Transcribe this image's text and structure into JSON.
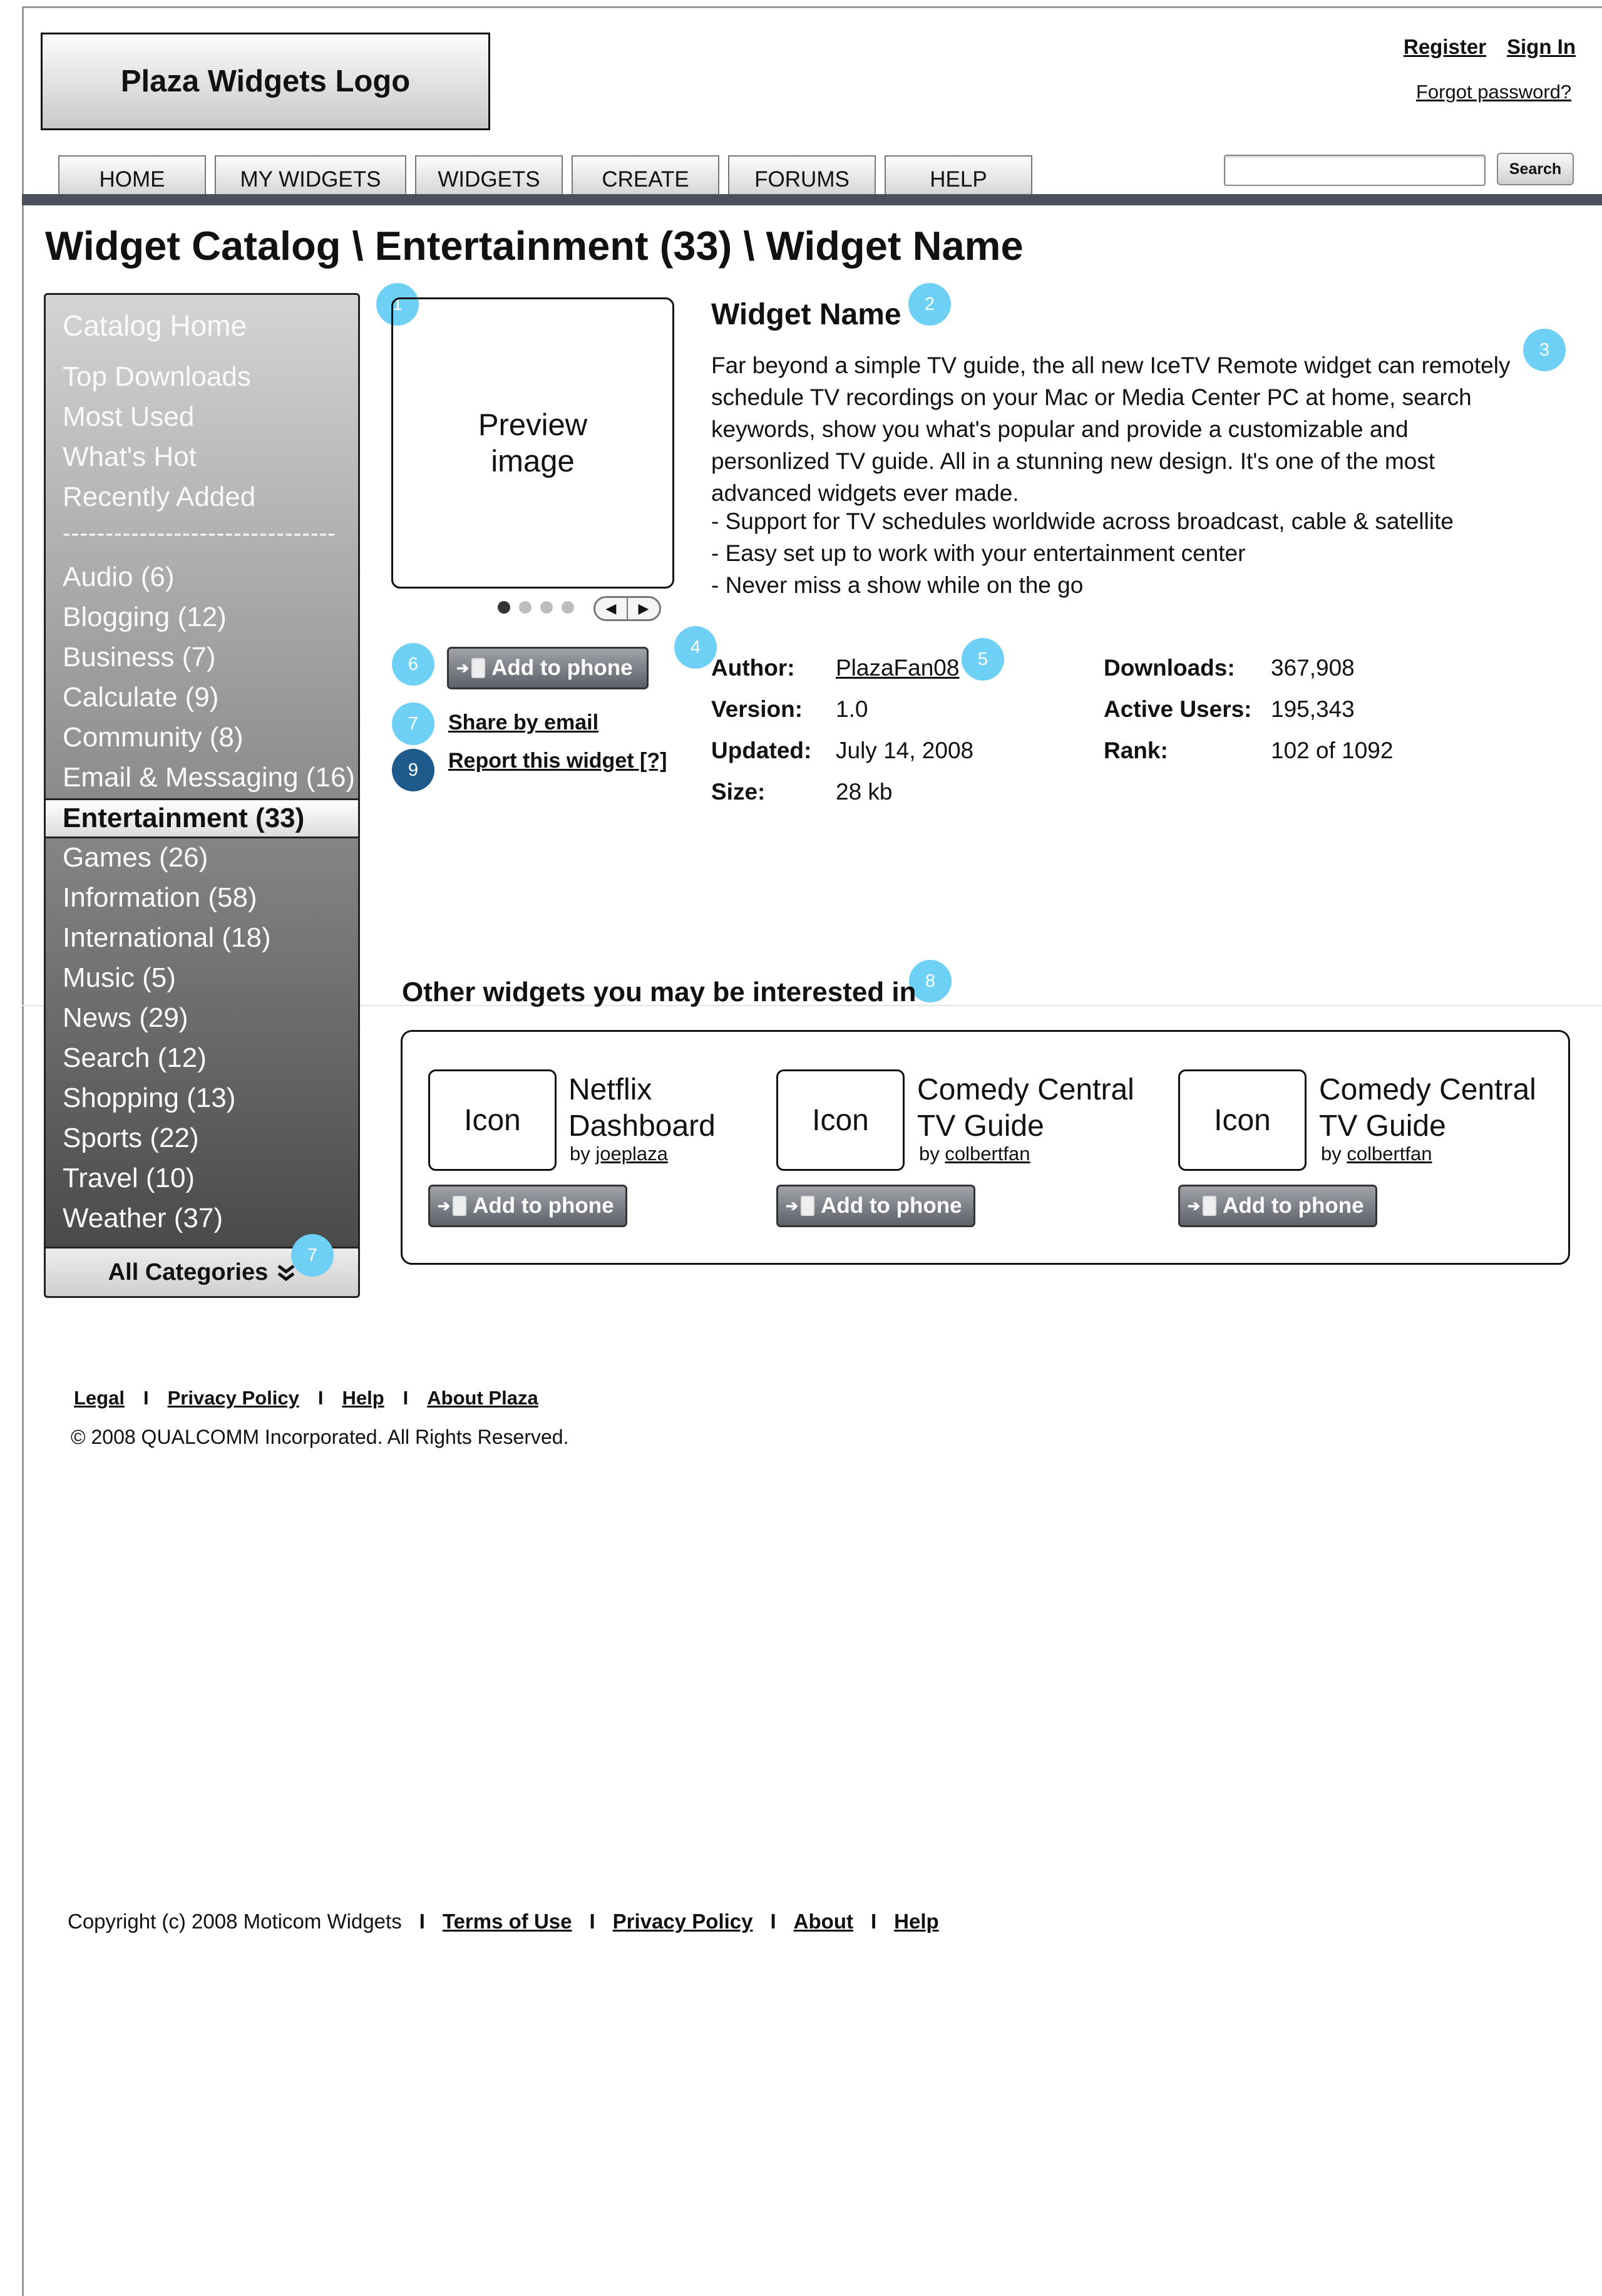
{
  "header": {
    "logo_text": "Plaza Widgets Logo",
    "register": "Register",
    "sign_in": "Sign In",
    "forgot_password": "Forgot password?"
  },
  "nav": {
    "tabs": [
      "HOME",
      "MY WIDGETS",
      "WIDGETS",
      "CREATE",
      "FORUMS",
      "HELP"
    ],
    "search_button": "Search",
    "search_value": ""
  },
  "breadcrumb": "Widget Catalog \\ Entertainment (33) \\ Widget Name",
  "sidebar": {
    "catalog_home": "Catalog Home",
    "quick_links": [
      "Top Downloads",
      "Most Used",
      "What's Hot",
      "Recently Added"
    ],
    "divider": "--------------------------------",
    "categories": [
      "Audio (6)",
      "Blogging (12)",
      "Business (7)",
      "Calculate (9)",
      "Community (8)",
      "Email & Messaging (16)",
      "Entertainment (33)",
      "Games (26)",
      "Information (58)",
      "International (18)",
      "Music (5)",
      "News (29)",
      "Search (12)",
      "Shopping (13)",
      "Sports (22)",
      "Travel (10)",
      "Weather (37)"
    ],
    "selected_category": "Entertainment (33)",
    "all_categories": "All Categories"
  },
  "badges": {
    "b1": "1",
    "b2": "2",
    "b3": "3",
    "b4": "4",
    "b5": "5",
    "b6": "6",
    "b7": "7",
    "b7b": "7",
    "b8": "8",
    "b9": "9"
  },
  "widget": {
    "preview_line1": "Preview",
    "preview_line2": "image",
    "name": "Widget Name",
    "description": "Far beyond a simple TV guide, the all new IceTV Remote widget can remotely schedule TV recordings on your Mac or Media Center PC at home, search keywords, show you what's popular and provide a customizable and personlized TV guide. All in a stunning new design. It's one of the most advanced widgets ever made.",
    "bullets": [
      "-  Support for TV schedules worldwide across broadcast, cable & satellite",
      "-  Easy set up to work with your entertainment center",
      "-  Never miss a show while on the go"
    ],
    "add_to_phone": "Add to phone",
    "share_email": "Share by email",
    "report": "Report this widget [?]",
    "meta": {
      "author_label": "Author:",
      "author": "PlazaFan08",
      "version_label": "Version:",
      "version": "1.0",
      "updated_label": "Updated:",
      "updated": "July 14, 2008",
      "size_label": "Size:",
      "size": "28 kb",
      "downloads_label": "Downloads:",
      "downloads": "367,908",
      "active_label": "Active Users:",
      "active": "195,343",
      "rank_label": "Rank:",
      "rank": "102 of 1092"
    }
  },
  "related": {
    "title": "Other widgets you may be interested in",
    "items": [
      {
        "icon": "Icon",
        "name1": "Netflix",
        "name2": "Dashboard",
        "by": "by ",
        "author": "joeplaza",
        "button": "Add to phone"
      },
      {
        "icon": "Icon",
        "name1": "Comedy Central",
        "name2": "TV Guide",
        "by": "by ",
        "author": "colbertfan",
        "button": "Add to phone"
      },
      {
        "icon": "Icon",
        "name1": "Comedy Central",
        "name2": "TV Guide",
        "by": "by ",
        "author": "colbertfan",
        "button": "Add to phone"
      }
    ]
  },
  "footer": {
    "links": [
      "Legal",
      "Privacy Policy",
      "Help",
      "About Plaza"
    ],
    "separator": "I",
    "copyright": "© 2008 QUALCOMM Incorporated. All Rights Reserved.",
    "bottom_copyright": "Copyright (c) 2008 Moticom Widgets",
    "bottom_links": [
      "Terms of Use",
      "Privacy Policy",
      "About",
      "Help"
    ]
  }
}
